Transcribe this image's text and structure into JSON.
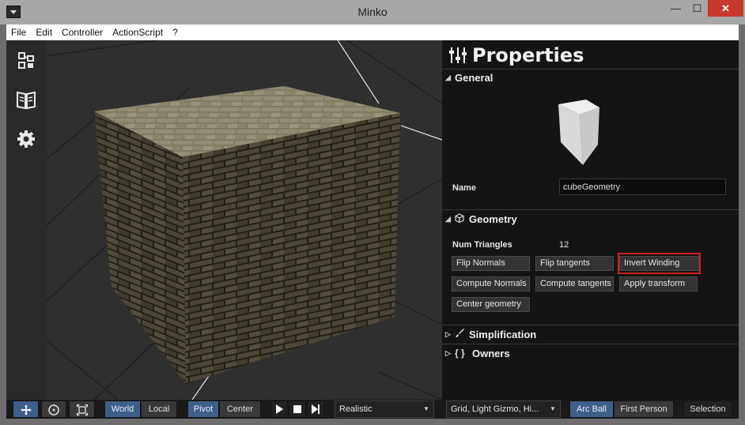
{
  "window": {
    "title": "Minko",
    "min_glyph": "—",
    "max_glyph": "☐",
    "close_glyph": "✕"
  },
  "menu": {
    "items": [
      "File",
      "Edit",
      "Controller",
      "ActionScript",
      "?"
    ]
  },
  "leftbar": {
    "icons": [
      "scene-graph-icon",
      "library-book-icon",
      "gear-icon"
    ]
  },
  "properties": {
    "title": "Properties",
    "general": {
      "header": "General",
      "name_label": "Name",
      "name_value": "cubeGeometry"
    },
    "geometry": {
      "header": "Geometry",
      "num_triangles_label": "Num Triangles",
      "num_triangles_value": "12",
      "buttons": [
        "Flip Normals",
        "Flip tangents",
        "Invert Winding",
        "Compute Normals",
        "Compute tangents",
        "Apply transform",
        "Center geometry"
      ]
    },
    "simplification": {
      "header": "Simplification"
    },
    "owners": {
      "header": "Owners",
      "icon_text": "{ }"
    }
  },
  "toolbar": {
    "transform_tools": [
      "move-icon",
      "rotate-icon",
      "scale-icon"
    ],
    "space": {
      "world": "World",
      "local": "Local",
      "active": "World"
    },
    "pivot": {
      "pivot": "Pivot",
      "center": "Center",
      "active": "Pivot"
    },
    "playback": [
      "play-icon",
      "stop-icon",
      "step-forward-icon"
    ],
    "render_mode": "Realistic",
    "display_options": "Grid, Light Gizmo, Hi...",
    "camera": {
      "arc_ball": "Arc Ball",
      "first_person": "First Person",
      "active": "Arc Ball"
    },
    "selection": "Selection"
  },
  "colors": {
    "accent": "#3d5f8a",
    "highlight": "#d21c1c",
    "panel_bg": "#141414",
    "viewport_bg": "#2f2f2f"
  }
}
